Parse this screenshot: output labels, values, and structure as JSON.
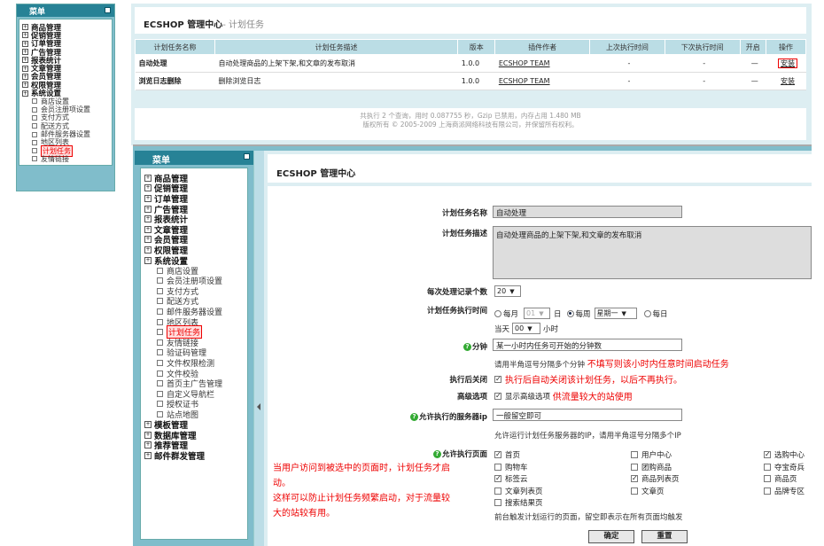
{
  "top": {
    "sidebar": {
      "title": "菜单",
      "items": [
        "商品管理",
        "促销管理",
        "订单管理",
        "广告管理",
        "报表统计",
        "文章管理",
        "会员管理",
        "权限管理",
        "系统设置"
      ],
      "sub_items": [
        "商店设置",
        "会员注册项设置",
        "支付方式",
        "配送方式",
        "邮件服务器设置",
        "地区列表",
        "计划任务",
        "友情链接"
      ]
    },
    "title": "ECSHOP 管理中心",
    "subtitle": "- 计划任务",
    "table": {
      "headers": [
        "计划任务名称",
        "计划任务描述",
        "版本",
        "插件作者",
        "上次执行时间",
        "下次执行时间",
        "开启",
        "操作"
      ],
      "rows": [
        {
          "name": "自动处理",
          "desc": "自动处理商品的上架下架,和文章的发布取消",
          "version": "1.0.0",
          "author": "ECSHOP TEAM",
          "last": "-",
          "next": "-",
          "enabled": "—",
          "action": "安装"
        },
        {
          "name": "浏览日志删除",
          "desc": "删除浏览日志",
          "version": "1.0.0",
          "author": "ECSHOP TEAM",
          "last": "-",
          "next": "-",
          "enabled": "—",
          "action": "安装"
        }
      ]
    },
    "footer_line1": "共执行 2 个查询，用时 0.087755 秒，Gzip 已禁用，内存占用 1.480 MB",
    "footer_line2": "版权所有 © 2005-2009 上海商派网络科技有限公司，并保留所有权利。"
  },
  "bottom": {
    "sidebar": {
      "title": "菜单",
      "items": [
        "商品管理",
        "促销管理",
        "订单管理",
        "广告管理",
        "报表统计",
        "文章管理",
        "会员管理",
        "权限管理",
        "系统设置"
      ],
      "sub_items": [
        "商店设置",
        "会员注册项设置",
        "支付方式",
        "配送方式",
        "邮件服务器设置",
        "地区列表",
        "计划任务",
        "友情链接",
        "验证码管理",
        "文件权限检测",
        "文件校验",
        "首页主广告管理",
        "自定义导航栏",
        "授权证书",
        "站点地图"
      ],
      "items_after": [
        "模板管理",
        "数据库管理",
        "推荐管理",
        "邮件群发管理"
      ]
    },
    "title": "ECSHOP 管理中心",
    "form": {
      "name_label": "计划任务名称",
      "name_value": "自动处理",
      "desc_label": "计划任务描述",
      "desc_value": "自动处理商品的上架下架,和文章的发布取消",
      "records_label": "每次处理记录个数",
      "records_value": "20",
      "time_label": "计划任务执行时间",
      "monthly": "每月",
      "monthly_value": "01",
      "day_unit": "日",
      "weekly": "每周",
      "weekly_value": "星期一",
      "daily": "每日",
      "hour_prefix": "当天",
      "hour_value": "00",
      "hour_unit": "小时",
      "minute_label": "分钟",
      "minute_value": "某一小时内任务可开始的分钟数",
      "minute_hint": "请用半角逗号分隔多个分钟",
      "minute_note": "不填写则该小时内任意时间启动任务",
      "close_label": "执行后关闭",
      "close_note": "执行后自动关闭该计划任务，以后不再执行。",
      "advanced_label": "高级选项",
      "advanced_option": "显示高级选项",
      "advanced_note": "供流量较大的站使用",
      "server_label": "允许执行的服务器ip",
      "server_value": "一般留空即可",
      "server_hint": "允许运行计划任务服务器的IP，请用半角逗号分隔多个IP",
      "pages_label": "允许执行页面",
      "pages": [
        [
          "首页",
          "用户中心",
          "选购中心"
        ],
        [
          "购物车",
          "团购商品",
          "夺宝奇兵"
        ],
        [
          "标签云",
          "商品列表页",
          "商品页"
        ],
        [
          "文章列表页",
          "文章页",
          "品牌专区"
        ],
        [
          "搜索结果页",
          "",
          ""
        ]
      ],
      "pages_checked": [
        [
          true,
          false,
          true
        ],
        [
          false,
          false,
          false
        ],
        [
          true,
          true,
          false
        ],
        [
          false,
          false,
          false
        ],
        [
          false,
          false,
          false
        ]
      ],
      "pages_hint": "前台触发计划运行的页面，留空即表示在所有页面均触发",
      "annotation": "当用户访问到被选中的页面时，计划任务才启动。这样可以防止计划任务频繁启动，对于流量较大的站较有用。",
      "annotation_lines": [
        "当用户访问到被选中的页面时，计划任务才启",
        "动。",
        "这样可以防止计划任务频繁启动，对于流量较",
        "大的站较有用。"
      ],
      "submit": "确定",
      "reset": "重置"
    }
  }
}
